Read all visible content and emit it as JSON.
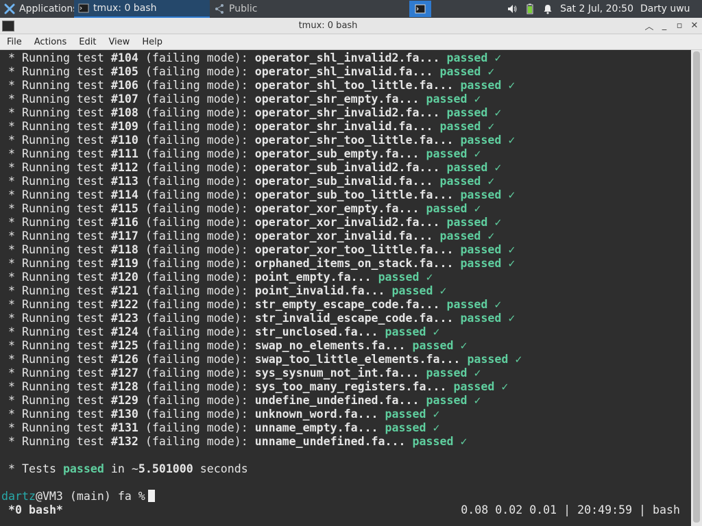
{
  "panel": {
    "apps_label": "Applications",
    "tasks": [
      {
        "label": "tmux: 0 bash"
      },
      {
        "label": "Public"
      }
    ],
    "clock": "Sat  2 Jul, 20:50",
    "user": "Darty uwu"
  },
  "window": {
    "title": "tmux: 0 bash",
    "menu": [
      "File",
      "Actions",
      "Edit",
      "View",
      "Help"
    ]
  },
  "terminal": {
    "bullet": "*",
    "running": "Running test",
    "mode": "(failing mode):",
    "passed": "passed",
    "check": "✓",
    "tests": [
      {
        "num": "#104",
        "file": "operator_shl_invalid2.fa..."
      },
      {
        "num": "#105",
        "file": "operator_shl_invalid.fa..."
      },
      {
        "num": "#106",
        "file": "operator_shl_too_little.fa..."
      },
      {
        "num": "#107",
        "file": "operator_shr_empty.fa..."
      },
      {
        "num": "#108",
        "file": "operator_shr_invalid2.fa..."
      },
      {
        "num": "#109",
        "file": "operator_shr_invalid.fa..."
      },
      {
        "num": "#110",
        "file": "operator_shr_too_little.fa..."
      },
      {
        "num": "#111",
        "file": "operator_sub_empty.fa..."
      },
      {
        "num": "#112",
        "file": "operator_sub_invalid2.fa..."
      },
      {
        "num": "#113",
        "file": "operator_sub_invalid.fa..."
      },
      {
        "num": "#114",
        "file": "operator_sub_too_little.fa..."
      },
      {
        "num": "#115",
        "file": "operator_xor_empty.fa..."
      },
      {
        "num": "#116",
        "file": "operator_xor_invalid2.fa..."
      },
      {
        "num": "#117",
        "file": "operator_xor_invalid.fa..."
      },
      {
        "num": "#118",
        "file": "operator_xor_too_little.fa..."
      },
      {
        "num": "#119",
        "file": "orphaned_items_on_stack.fa..."
      },
      {
        "num": "#120",
        "file": "point_empty.fa..."
      },
      {
        "num": "#121",
        "file": "point_invalid.fa..."
      },
      {
        "num": "#122",
        "file": "str_empty_escape_code.fa..."
      },
      {
        "num": "#123",
        "file": "str_invalid_escape_code.fa..."
      },
      {
        "num": "#124",
        "file": "str_unclosed.fa..."
      },
      {
        "num": "#125",
        "file": "swap_no_elements.fa..."
      },
      {
        "num": "#126",
        "file": "swap_too_little_elements.fa..."
      },
      {
        "num": "#127",
        "file": "sys_sysnum_not_int.fa..."
      },
      {
        "num": "#128",
        "file": "sys_too_many_registers.fa..."
      },
      {
        "num": "#129",
        "file": "undefine_undefined.fa..."
      },
      {
        "num": "#130",
        "file": "unknown_word.fa..."
      },
      {
        "num": "#131",
        "file": "unname_empty.fa..."
      },
      {
        "num": "#132",
        "file": "unname_undefined.fa..."
      }
    ],
    "summary": {
      "prefix": "* Tests",
      "passed": "passed",
      "middle": "in ~",
      "time": "5.501000",
      "suffix": "seconds"
    },
    "prompt": {
      "user": "dartz",
      "rest": "@VM3 (main) fa %"
    }
  },
  "statusbar": {
    "left": "*0 bash*",
    "right": "0.08 0.02 0.01 | 20:49:59 | bash"
  }
}
